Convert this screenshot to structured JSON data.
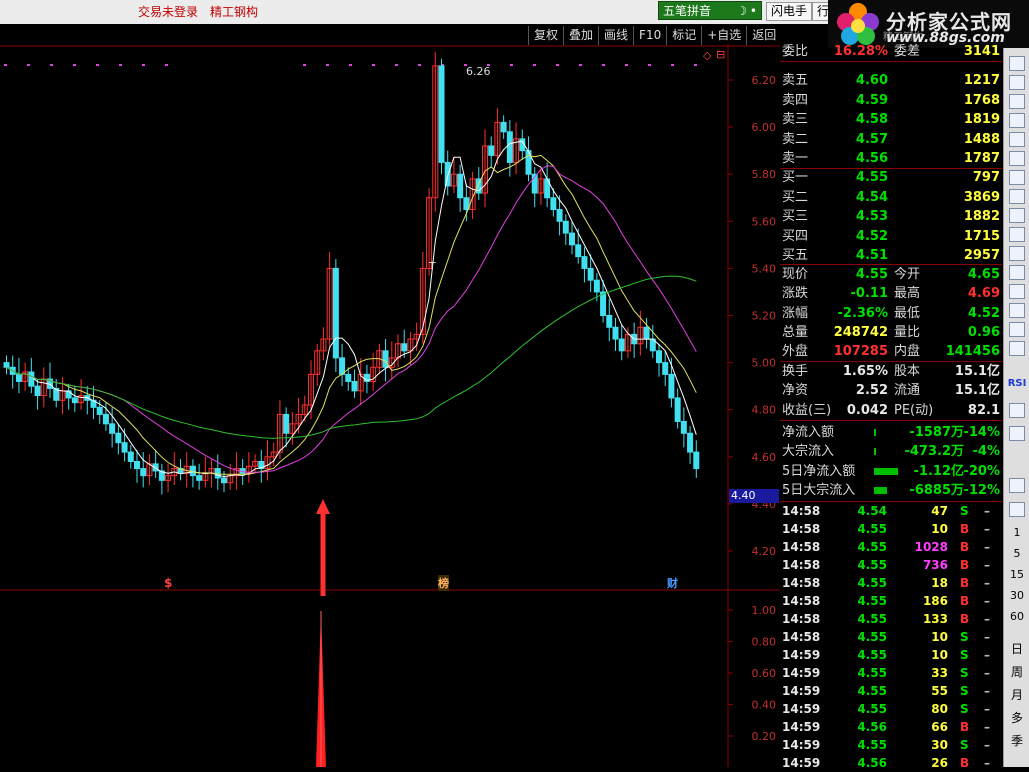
{
  "topbar": {
    "login_status": "交易未登录",
    "stock_name": "精工钢构",
    "ime_label": "五笔拼音",
    "ime_glyph": "☽",
    "flash_trade": "闪电手",
    "market": "行"
  },
  "logo": {
    "name": "分析家公式网",
    "url": "www.88gs.com",
    "faded": "精工钢构"
  },
  "toolbar": {
    "items": [
      "复权",
      "叠加",
      "画线",
      "F10",
      "标记",
      "+自选",
      "返回"
    ],
    "corner_icons": [
      "◇",
      "⊟"
    ]
  },
  "main_chart": {
    "y_ticks": [
      "6.20",
      "6.00",
      "5.80",
      "5.60",
      "5.40",
      "5.20",
      "5.00",
      "4.80",
      "4.60",
      "4.40",
      "4.20"
    ],
    "high_label": "6.26",
    "current_price": "4.40",
    "markers": [
      {
        "text": "$",
        "color": "#ff4040"
      },
      {
        "text": "榜",
        "color": "#ffb060"
      },
      {
        "text": "财",
        "color": "#4a9cff"
      }
    ],
    "small_t": "T"
  },
  "sub_chart": {
    "y_ticks": [
      "1.00",
      "0.80",
      "0.60",
      "0.40",
      "0.20"
    ]
  },
  "quote": {
    "ratio": {
      "label": "委比",
      "value": "16.28%",
      "label2": "委差",
      "value2": "3141"
    },
    "asks": [
      {
        "label": "卖五",
        "price": "4.60",
        "vol": "1217"
      },
      {
        "label": "卖四",
        "price": "4.59",
        "vol": "1768"
      },
      {
        "label": "卖三",
        "price": "4.58",
        "vol": "1819"
      },
      {
        "label": "卖二",
        "price": "4.57",
        "vol": "1488"
      },
      {
        "label": "卖一",
        "price": "4.56",
        "vol": "1787"
      }
    ],
    "bids": [
      {
        "label": "买一",
        "price": "4.55",
        "vol": "797"
      },
      {
        "label": "买二",
        "price": "4.54",
        "vol": "3869"
      },
      {
        "label": "买三",
        "price": "4.53",
        "vol": "1882"
      },
      {
        "label": "买四",
        "price": "4.52",
        "vol": "1715"
      },
      {
        "label": "买五",
        "price": "4.51",
        "vol": "2957"
      }
    ],
    "stats": [
      {
        "l1": "现价",
        "v1": "4.55",
        "c1": "#00e000",
        "l2": "今开",
        "v2": "4.65",
        "c2": "#00e000"
      },
      {
        "l1": "涨跌",
        "v1": "-0.11",
        "c1": "#00e000",
        "l2": "最高",
        "v2": "4.69",
        "c2": "#ff3030"
      },
      {
        "l1": "涨幅",
        "v1": "-2.36%",
        "c1": "#00e000",
        "l2": "最低",
        "v2": "4.52",
        "c2": "#00e000"
      },
      {
        "l1": "总量",
        "v1": "248742",
        "c1": "#ffff40",
        "l2": "量比",
        "v2": "0.96",
        "c2": "#00e000"
      },
      {
        "l1": "外盘",
        "v1": "107285",
        "c1": "#ff3030",
        "l2": "内盘",
        "v2": "141456",
        "c2": "#00e000"
      }
    ],
    "stats2": [
      {
        "l1": "换手",
        "v1": "1.65%",
        "l2": "股本",
        "v2": "15.1亿"
      },
      {
        "l1": "净资",
        "v1": "2.52",
        "l2": "流通",
        "v2": "15.1亿"
      },
      {
        "l1": "收益(三)",
        "v1": "0.042",
        "l2": "PE(动)",
        "v2": "82.1"
      }
    ],
    "flows": [
      {
        "label": "净流入额",
        "value": "-1587万",
        "pct": "-14%",
        "bar": 0.05
      },
      {
        "label": "大宗流入",
        "value": "-473.2万",
        "pct": "-4%",
        "bar": 0.05
      },
      {
        "label": "5日净流入额",
        "value": "-1.12亿",
        "pct": "-20%",
        "bar": 1.0
      },
      {
        "label": "5日大宗流入",
        "value": "-6885万",
        "pct": "-12%",
        "bar": 0.55
      }
    ]
  },
  "ticks": [
    {
      "time": "14:58",
      "price": "4.54",
      "vol": "47",
      "side": "S",
      "vc": "#ffff40"
    },
    {
      "time": "14:58",
      "price": "4.55",
      "vol": "10",
      "side": "B",
      "vc": "#ffff40"
    },
    {
      "time": "14:58",
      "price": "4.55",
      "vol": "1028",
      "side": "B",
      "vc": "#ff40ff"
    },
    {
      "time": "14:58",
      "price": "4.55",
      "vol": "736",
      "side": "B",
      "vc": "#ff40ff"
    },
    {
      "time": "14:58",
      "price": "4.55",
      "vol": "18",
      "side": "B",
      "vc": "#ffff40"
    },
    {
      "time": "14:58",
      "price": "4.55",
      "vol": "186",
      "side": "B",
      "vc": "#ffff40"
    },
    {
      "time": "14:58",
      "price": "4.55",
      "vol": "133",
      "side": "B",
      "vc": "#ffff40"
    },
    {
      "time": "14:58",
      "price": "4.55",
      "vol": "10",
      "side": "S",
      "vc": "#ffff40"
    },
    {
      "time": "14:59",
      "price": "4.55",
      "vol": "10",
      "side": "S",
      "vc": "#ffff40"
    },
    {
      "time": "14:59",
      "price": "4.55",
      "vol": "33",
      "side": "S",
      "vc": "#ffff40"
    },
    {
      "time": "14:59",
      "price": "4.55",
      "vol": "55",
      "side": "S",
      "vc": "#ffff40"
    },
    {
      "time": "14:59",
      "price": "4.55",
      "vol": "80",
      "side": "S",
      "vc": "#ffff40"
    },
    {
      "time": "14:59",
      "price": "4.56",
      "vol": "66",
      "side": "B",
      "vc": "#ffff40"
    },
    {
      "time": "14:59",
      "price": "4.55",
      "vol": "30",
      "side": "S",
      "vc": "#ffff40"
    },
    {
      "time": "14:59",
      "price": "4.56",
      "vol": "26",
      "side": "B",
      "vc": "#ffff40"
    }
  ],
  "tick_dash": "–",
  "right_strip": {
    "numbers": [
      "1",
      "5",
      "15",
      "30",
      "60"
    ],
    "periods": [
      "日",
      "周",
      "月",
      "多",
      "季"
    ],
    "rsi": "RSI"
  },
  "colors": {
    "up": "#ff3030",
    "down": "#40e0f0",
    "ma5": "#ffffff",
    "ma10": "#e0e060",
    "ma20": "#e040e0",
    "ma60": "#30c030"
  }
}
